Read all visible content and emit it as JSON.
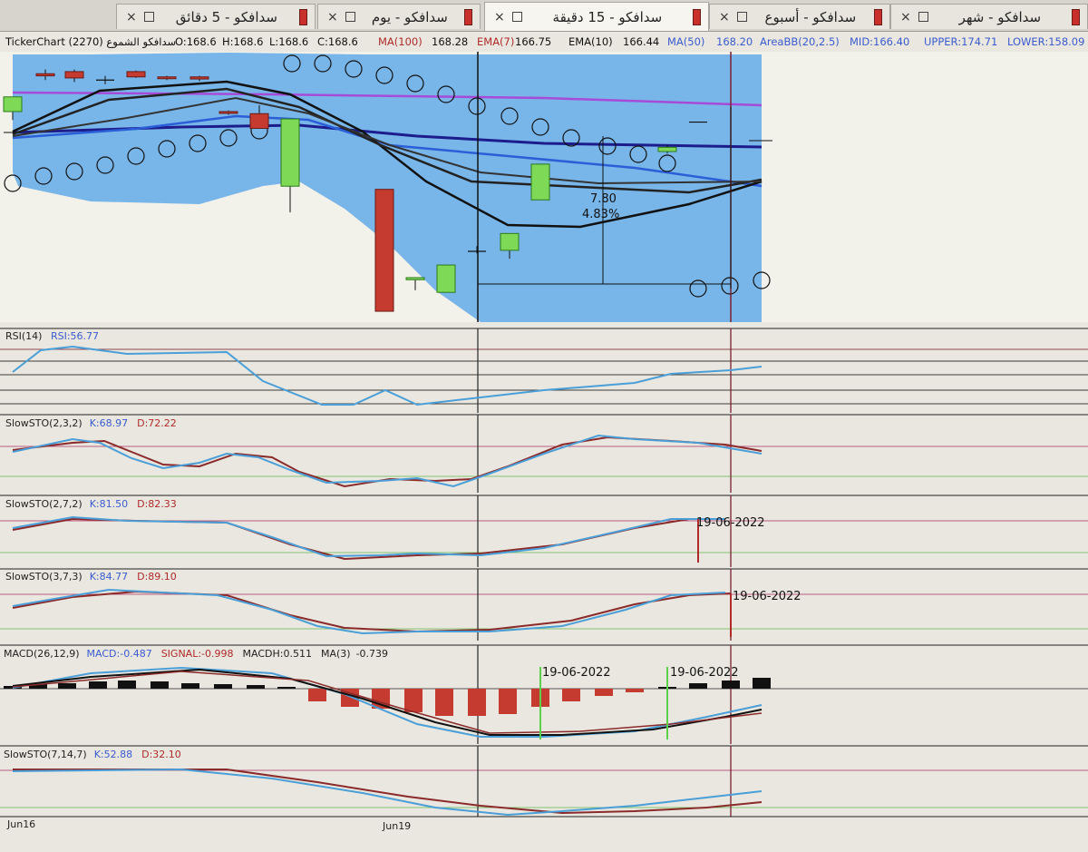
{
  "tabs": [
    {
      "label": "سدافكو - 5 دقائق",
      "active": false
    },
    {
      "label": "سدافكو - يوم",
      "active": false
    },
    {
      "label": "سدافكو - 15 دقيقة",
      "active": true
    },
    {
      "label": "سدافكو - أسبوع",
      "active": false
    },
    {
      "label": "سدافكو - شهر",
      "active": false
    }
  ],
  "status": {
    "symbol": "TickerChart سدافكو الشموع (2270)",
    "open": "O:168.6",
    "high": "H:168.6",
    "low": "L:168.6",
    "close": "C:168.6",
    "ma100_label": "MA(100)",
    "ma100_value": "168.28",
    "ema7_label": "EMA(7)",
    "ema7_value": "166.75",
    "ema10_label": "EMA(10)",
    "ema10_value": "166.44",
    "ma50_label": "MA(50)",
    "ma50_value": "168.20",
    "bb_label": "AreaBB(20,2.5)",
    "bb_mid": "MID:166.40",
    "bb_upper": "UPPER:174.71",
    "bb_lower": "LOWER:158.09"
  },
  "annotation": {
    "change_value": "7.80",
    "change_pct": "4.83%"
  },
  "panels": {
    "rsi": {
      "label": "RSI(14)",
      "value": "RSI:56.77"
    },
    "sto1": {
      "label": "SlowSTO(2,3,2)",
      "k": "K:68.97",
      "d": "D:72.22"
    },
    "sto2": {
      "label": "SlowSTO(2,7,2)",
      "k": "K:81.50",
      "d": "D:82.33",
      "date": "19-06-2022"
    },
    "sto3": {
      "label": "SlowSTO(3,7,3)",
      "k": "K:84.77",
      "d": "D:89.10",
      "date": "19-06-2022"
    },
    "macd": {
      "label": "MACD(26,12,9)",
      "macd": "MACD:-0.487",
      "signal": "SIGNAL:-0.998",
      "hist": "MACDH:0.511",
      "ma3": "MA(3)",
      "ma3_value": "-0.739",
      "date1": "19-06-2022",
      "date2": "19-06-2022"
    },
    "sto4": {
      "label": "SlowSTO(7,14,7)",
      "k": "K:52.88",
      "d": "D:32.10"
    }
  },
  "xaxis": {
    "labels": [
      "Jun16",
      "Jun19"
    ]
  },
  "colors": {
    "bullish": "#7ed957",
    "bearish": "#c63b2f",
    "bb_fill": "#6aaee8",
    "k_line": "#4a9fd8",
    "d_line": "#8b2a2a",
    "ma_line": "#1c1c8c",
    "upper_line": "#a64bd8"
  },
  "chart_data": {
    "type": "candlestick",
    "candles": [
      {
        "o": 169.6,
        "h": 170.4,
        "l": 168.8,
        "c": 171.0
      },
      {
        "o": 173.2,
        "h": 173.6,
        "l": 172.6,
        "c": 173.0
      },
      {
        "o": 173.4,
        "h": 173.6,
        "l": 172.4,
        "c": 172.8
      },
      {
        "o": 172.6,
        "h": 173.0,
        "l": 172.2,
        "c": 172.6
      },
      {
        "o": 173.4,
        "h": 173.5,
        "l": 172.8,
        "c": 172.9
      },
      {
        "o": 172.9,
        "h": 173.0,
        "l": 172.6,
        "c": 172.8
      },
      {
        "o": 172.9,
        "h": 173.0,
        "l": 172.5,
        "c": 172.7
      },
      {
        "o": 169.6,
        "h": 169.7,
        "l": 169.3,
        "c": 169.5
      },
      {
        "o": 169.4,
        "h": 170.2,
        "l": 168.0,
        "c": 168.0
      },
      {
        "o": 162.5,
        "h": 168.9,
        "l": 160.0,
        "c": 168.9
      },
      {
        "o": 162.2,
        "h": 162.2,
        "l": 150.6,
        "c": 150.6
      },
      {
        "o": 153.6,
        "h": 153.8,
        "l": 152.6,
        "c": 153.8
      },
      {
        "o": 152.4,
        "h": 155.0,
        "l": 152.4,
        "c": 155.0
      },
      {
        "o": 156.3,
        "h": 156.8,
        "l": 156.1,
        "c": 156.3
      },
      {
        "o": 156.4,
        "h": 158.0,
        "l": 155.6,
        "c": 158.0
      },
      {
        "o": 161.2,
        "h": 164.6,
        "l": 161.2,
        "c": 164.6
      },
      {
        "o": 165.8,
        "h": 166.4,
        "l": 165.6,
        "c": 166.2
      },
      {
        "o": 168.6,
        "h": 168.6,
        "l": 168.6,
        "c": 168.6
      }
    ]
  }
}
